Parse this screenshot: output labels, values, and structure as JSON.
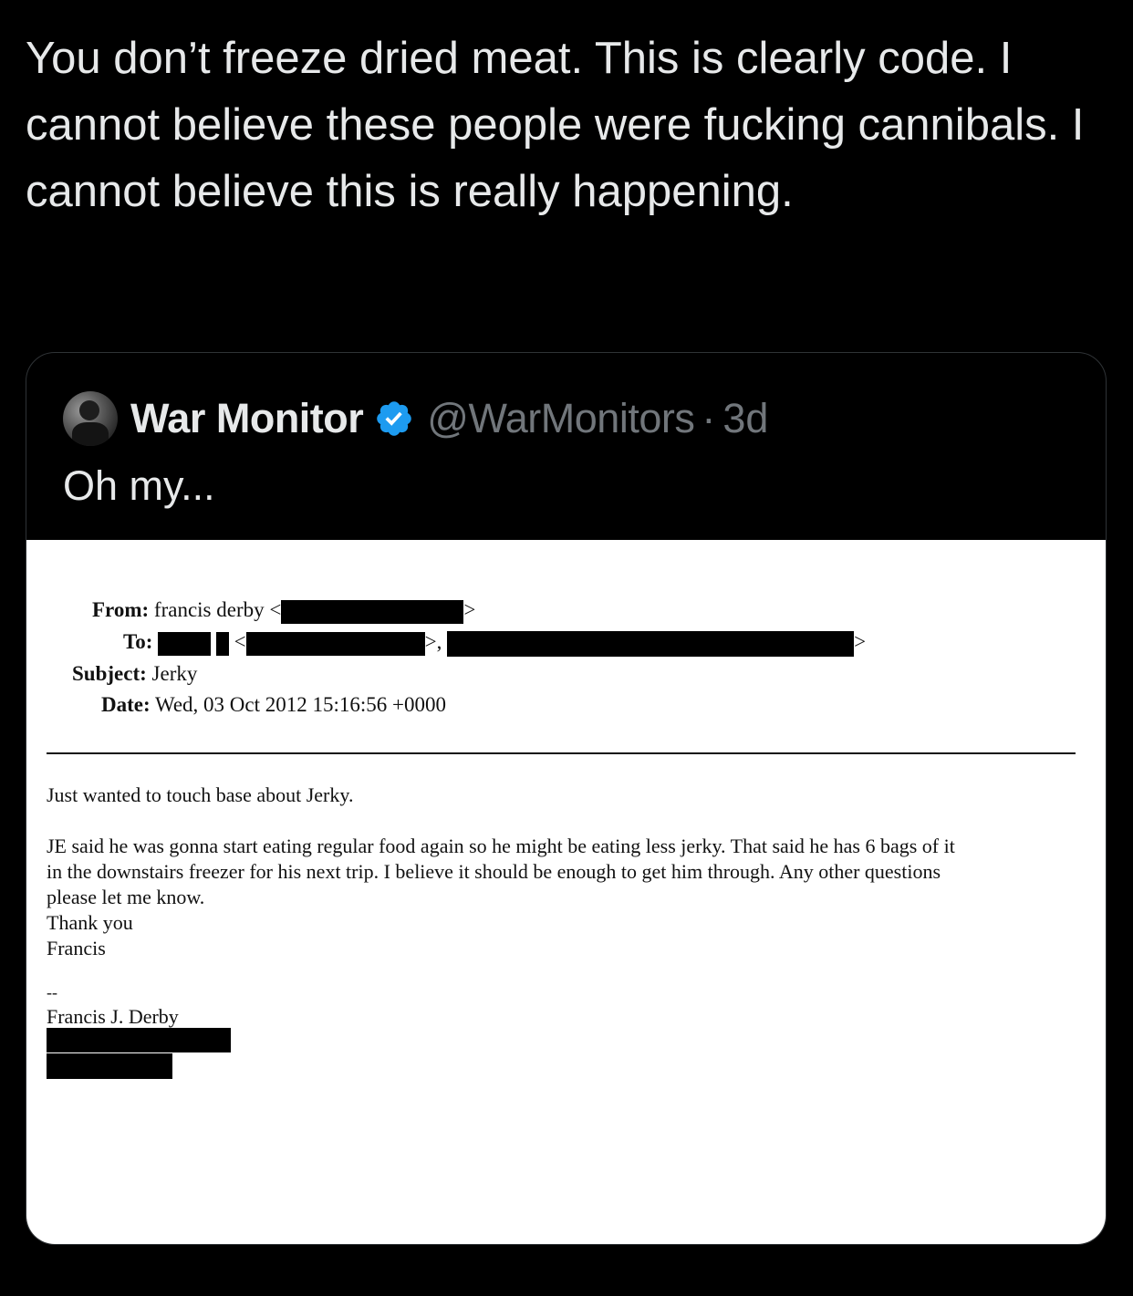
{
  "tweet": {
    "text": "You don’t freeze dried meat. This is clearly code. I cannot believe these people were fucking cannibals. I cannot believe this is really happening."
  },
  "quote": {
    "display_name": "War Monitor",
    "handle": "@WarMonitors",
    "separator": "·",
    "age": "3d",
    "text": "Oh my...",
    "accent_color": "#1d9bf0"
  },
  "email": {
    "from_label": "From:",
    "from_value": "francis derby <",
    "from_close": ">",
    "to_label": "To:",
    "to_open": "<",
    "to_sep": ">,",
    "to_close": ">",
    "subject_label": "Subject:",
    "subject_value": "Jerky",
    "date_label": "Date:",
    "date_value": "Wed, 03 Oct 2012 15:16:56 +0000",
    "body_lines": [
      "Just wanted to touch base about Jerky.",
      "JE said he was gonna start eating regular food again so he might be eating less jerky. That said he has 6 bags of it",
      "in the downstairs freezer for his next trip. I believe it should be enough to get him through. Any other questions",
      "please let me know.",
      "Thank you",
      "Francis",
      "--",
      "Francis J. Derby"
    ]
  }
}
